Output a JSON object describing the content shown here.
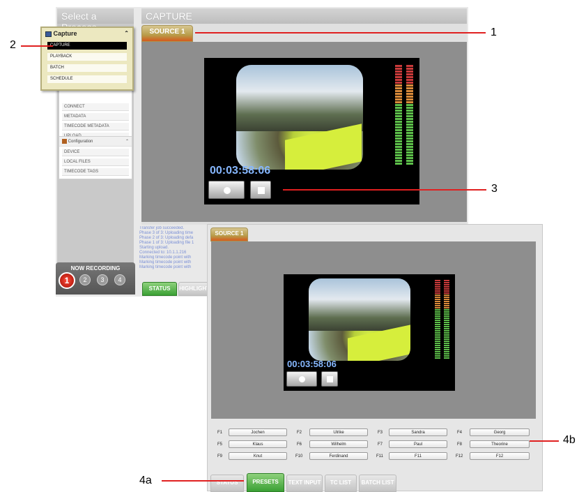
{
  "select_process_header": "Select a Process",
  "capture_header": "CAPTURE",
  "source_tab": "SOURCE 1",
  "capture_popup": {
    "title": "Capture",
    "items": [
      "CAPTURE",
      "PLAYBACK",
      "BATCH",
      "SCHEDULE"
    ]
  },
  "side_panel_items": [
    "CONNECT",
    "METADATA",
    "TIMECODE METADATA",
    "UPLOAD"
  ],
  "configuration": {
    "title": "Configuration",
    "items": [
      "DEVICE",
      "LOCAL FILES",
      "TIMECODE TAGS"
    ]
  },
  "now_recording": {
    "label": "NOW RECORDING",
    "sources": [
      "1",
      "2",
      "3",
      "4"
    ]
  },
  "timecode": "00:03:58:06",
  "status_log": [
    "Transfer job succeeded.",
    "Phase 3 of 3: Uploading time",
    "Phase 2 of 3: Uploading defa",
    "Phase 1 of 3: Uploading file 1",
    "Starting upload.",
    "Connected to: 10.1.1.216",
    "Marking timecode point with",
    "Marking timecode point with",
    "Marking timecode point with"
  ],
  "status_tabs": [
    "STATUS",
    "HIGHLIGHT"
  ],
  "fkeys": [
    {
      "key": "F1",
      "label": "Jochen"
    },
    {
      "key": "F2",
      "label": "Ulrike"
    },
    {
      "key": "F3",
      "label": "Sandra"
    },
    {
      "key": "F4",
      "label": "Georg"
    },
    {
      "key": "F5",
      "label": "Klaus"
    },
    {
      "key": "F6",
      "label": "Wilhelm"
    },
    {
      "key": "F7",
      "label": "Paul"
    },
    {
      "key": "F8",
      "label": "Theorine"
    },
    {
      "key": "F9",
      "label": "Knut"
    },
    {
      "key": "F10",
      "label": "Ferdinand"
    },
    {
      "key": "F11",
      "label": "F11"
    },
    {
      "key": "F12",
      "label": "F12"
    }
  ],
  "bottom_tabs": [
    "STATUS",
    "PRESETS",
    "TEXT INPUT",
    "TC LIST",
    "BATCH LIST"
  ],
  "callouts": [
    "1",
    "2",
    "3",
    "4a",
    "4b"
  ],
  "colors": {
    "accent_orange": "#d55a1c",
    "accent_green": "#3aa034",
    "callout_red": "#e02020",
    "timecode_blue": "#86b7ff"
  }
}
